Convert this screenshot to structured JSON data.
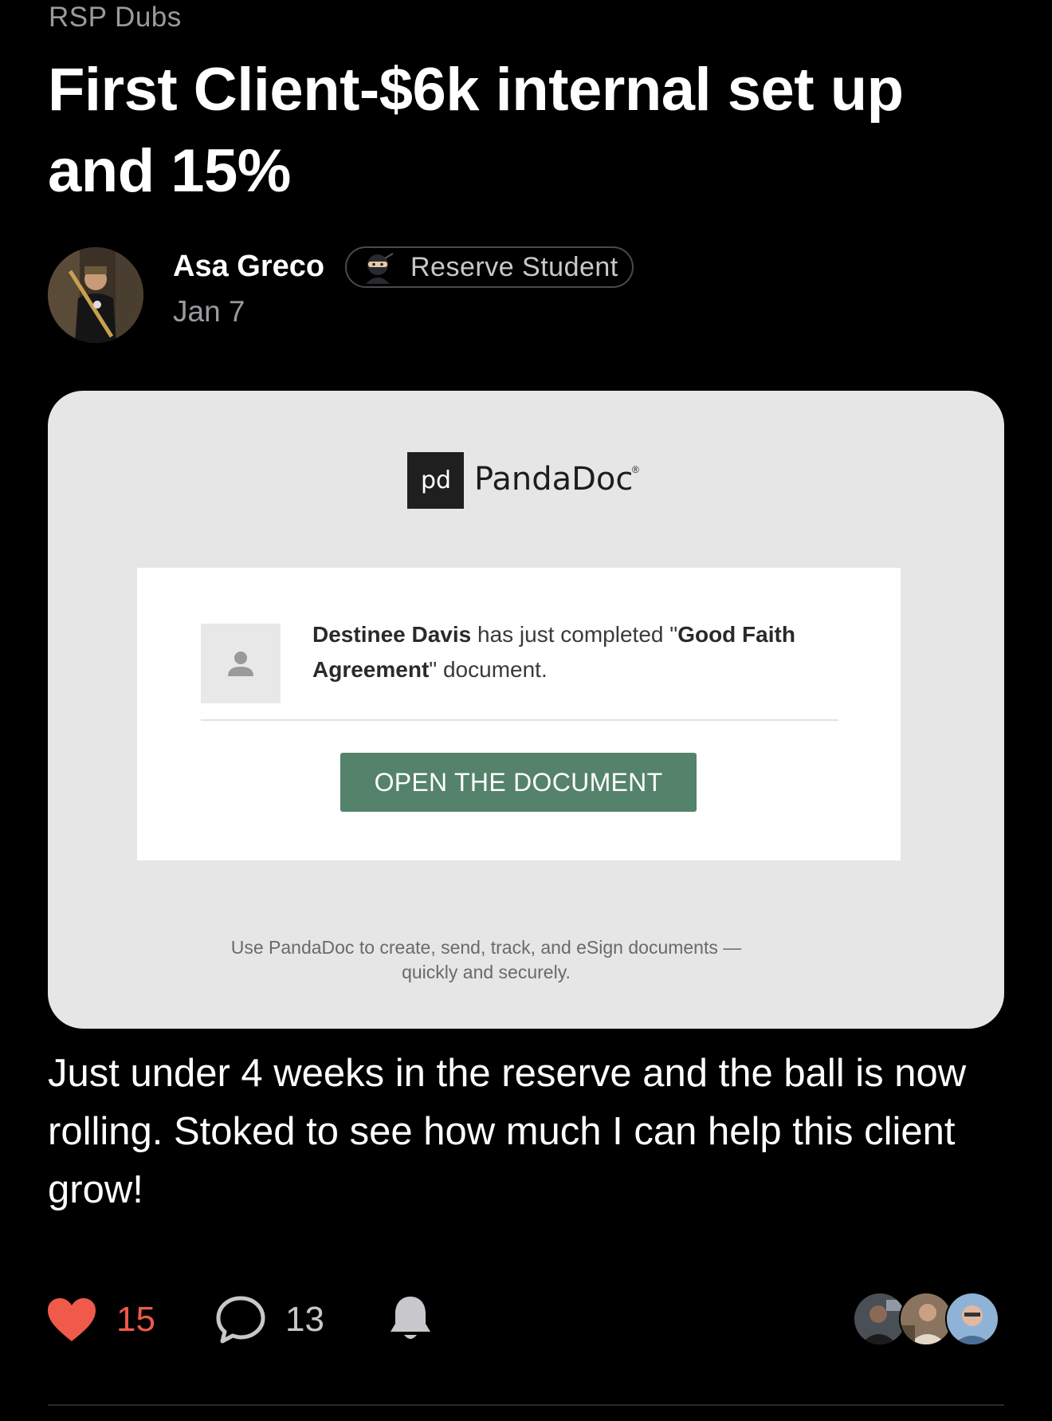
{
  "post": {
    "group": "RSP Dubs",
    "title": "First Client-$6k internal set up and 15%",
    "author": "Asa Greco",
    "badge": "Reserve Student",
    "date": "Jan 7",
    "body": "Just under 4 weeks in the reserve and the ball is now rolling. Stoked to see how much I can help this client grow!"
  },
  "attachment": {
    "brand": "PandaDoc",
    "brand_mark": "®",
    "logo_text": "pd",
    "signer": "Destinee Davis",
    "message_middle": " has just completed \"",
    "document_name_part1": "Good Faith",
    "document_name_part2": "Agreement",
    "message_end": "\" document.",
    "button_label": "OPEN THE DOCUMENT",
    "footer_line1": "Use PandaDoc to create, send, track, and eSign documents —",
    "footer_line2": "quickly and securely."
  },
  "actions": {
    "likes": "15",
    "comments": "13"
  },
  "colors": {
    "background": "#000000",
    "like_red": "#ef5a4a",
    "button_green": "#54826b",
    "card_gray": "#e6e6e6"
  },
  "icons": [
    "heart-icon",
    "comment-icon",
    "bell-icon",
    "ninja-icon",
    "person-placeholder-icon",
    "pandadoc-logo"
  ]
}
